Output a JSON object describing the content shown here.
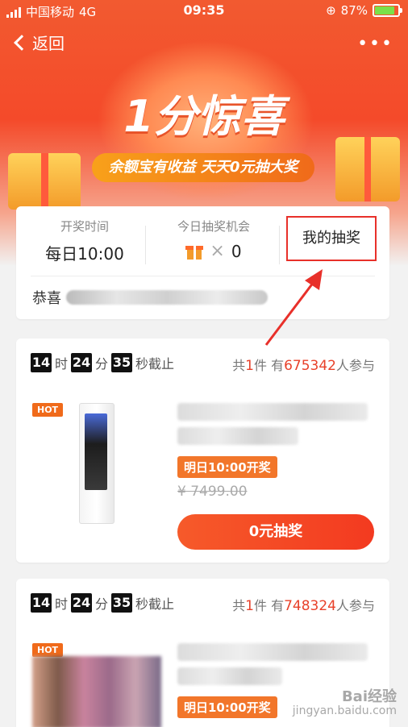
{
  "status": {
    "carrier": "中国移动",
    "network": "4G",
    "time": "09:35",
    "battery": "87%",
    "battery_level": 0.87
  },
  "nav": {
    "back_label": "返回",
    "more_label": "•••"
  },
  "hero": {
    "title": "1分惊喜",
    "subtitle": "余额宝有收益 天天0元抽大奖"
  },
  "info": {
    "draw_time_label": "开奖时间",
    "draw_time_value": "每日10:00",
    "chances_label": "今日抽奖机会",
    "chances_times": "×",
    "chances_value": "0",
    "my_lottery": "我的抽奖",
    "congrats": "恭喜"
  },
  "products": [
    {
      "h": "14",
      "h_label": "时",
      "m": "24",
      "m_label": "分",
      "s": "35",
      "s_label": "秒截止",
      "total_prefix": "共",
      "total_count": "1",
      "total_unit": "件",
      "join_prefix": "有",
      "join_count": "675342",
      "join_suffix": "人参与",
      "hot": "HOT",
      "badge": "明日10:00开奖",
      "old_price": "¥ 7499.00",
      "button": "0元抽奖"
    },
    {
      "h": "14",
      "h_label": "时",
      "m": "24",
      "m_label": "分",
      "s": "35",
      "s_label": "秒截止",
      "total_prefix": "共",
      "total_count": "1",
      "total_unit": "件",
      "join_prefix": "有",
      "join_count": "748324",
      "join_suffix": "人参与",
      "hot": "HOT",
      "badge": "明日10:00开奖"
    }
  ],
  "watermark": {
    "brand": "Bai经验",
    "url": "jingyan.baidu.com"
  },
  "colors": {
    "accent_red": "#e8412a",
    "orange": "#f2762a"
  }
}
